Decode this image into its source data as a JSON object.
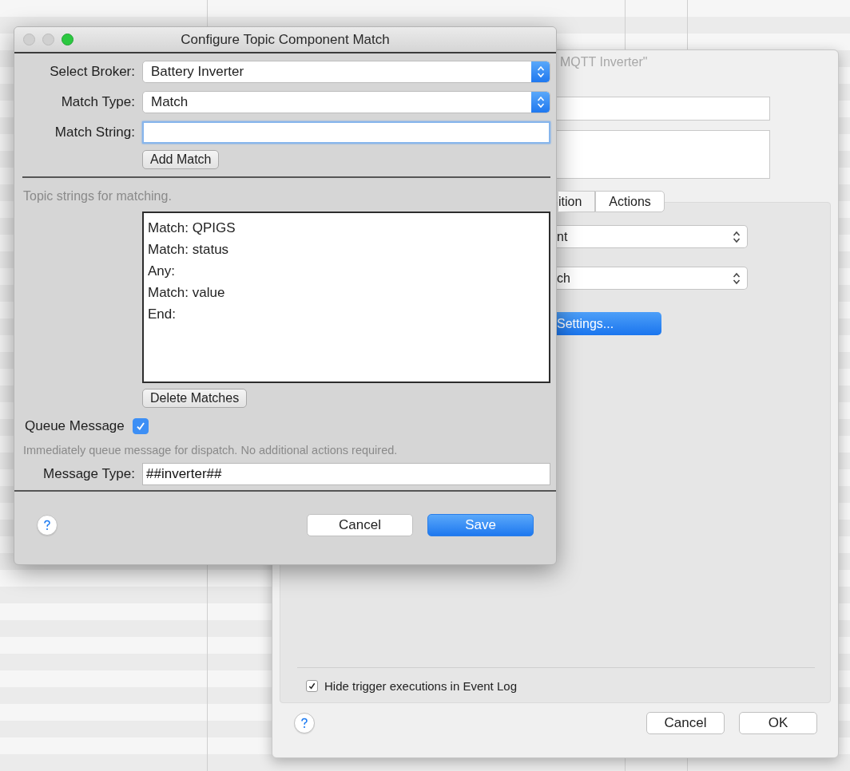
{
  "back_window": {
    "title": "MQTT Inverter\"",
    "tabs": [
      {
        "label": "ition",
        "selected": false
      },
      {
        "label": "Actions",
        "selected": true
      }
    ],
    "popups": [
      "nt",
      "ch"
    ],
    "settings_button": "Settings...",
    "hide_trigger": {
      "label": "Hide trigger executions in Event Log",
      "checked": true
    },
    "buttons": [
      {
        "label": "Cancel",
        "kind": "plain"
      },
      {
        "label": "OK",
        "kind": "plain"
      }
    ]
  },
  "dialog": {
    "title": "Configure Topic Component Match",
    "fields": [
      {
        "kind": "select",
        "label": "Select Broker:",
        "value": "Battery Inverter"
      },
      {
        "kind": "select",
        "label": "Match Type:",
        "value": "Match"
      },
      {
        "kind": "text",
        "label": "Match String:",
        "focused": true
      }
    ],
    "add_button": "Add Match",
    "list_caption": "Topic strings for matching.",
    "matches": [
      "Match: QPIGS",
      "Match: status",
      "Any:",
      "Match: value",
      "End:"
    ],
    "delete_button": "Delete Matches",
    "queue": {
      "label": "Queue Message",
      "checked": true
    },
    "queue_note": "Immediately queue message for dispatch.  No additional actions required.",
    "message_type": {
      "label": "Message Type:",
      "value": "##inverter##"
    },
    "buttons": [
      {
        "label": "Cancel",
        "kind": "plain"
      },
      {
        "label": "Save",
        "kind": "default"
      }
    ]
  }
}
